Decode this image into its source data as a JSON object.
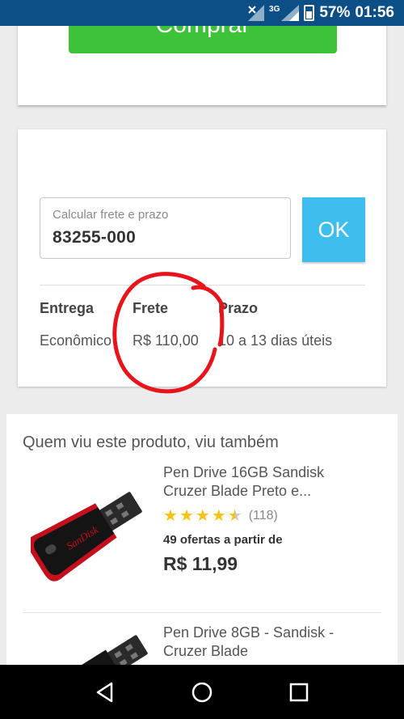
{
  "status_bar": {
    "network": "3G",
    "battery": "57%",
    "time": "01:56"
  },
  "buy_card": {
    "buy_button": "Comprar"
  },
  "freight": {
    "cep_label": "Calcular frete e prazo",
    "cep_value": "83255-000",
    "ok_button": "OK",
    "headers": {
      "delivery": "Entrega",
      "freight": "Frete",
      "term": "Prazo"
    },
    "row": {
      "delivery": "Econômico",
      "freight": "R$ 110,00",
      "term": "10 a 13 dias úteis"
    },
    "annotation_color": "#e8141b"
  },
  "related": {
    "title": "Quem viu este produto, viu também",
    "products": [
      {
        "name": "Pen Drive 16GB Sandisk Cruzer Blade Preto e...",
        "rating": 4.5,
        "reviews": "(118)",
        "offers": "49 ofertas a partir de",
        "price": "R$ 11,99",
        "brand_on_image": "SanDisk"
      },
      {
        "name": "Pen Drive 8GB - Sandisk - Cruzer Blade"
      }
    ]
  },
  "colors": {
    "status_bar": "#0c4f86",
    "buy_button": "#3ec23a",
    "ok_button": "#3ebdef",
    "star": "#f5c310"
  },
  "icons": {
    "nav": [
      "back-icon",
      "home-icon",
      "recents-icon"
    ]
  }
}
